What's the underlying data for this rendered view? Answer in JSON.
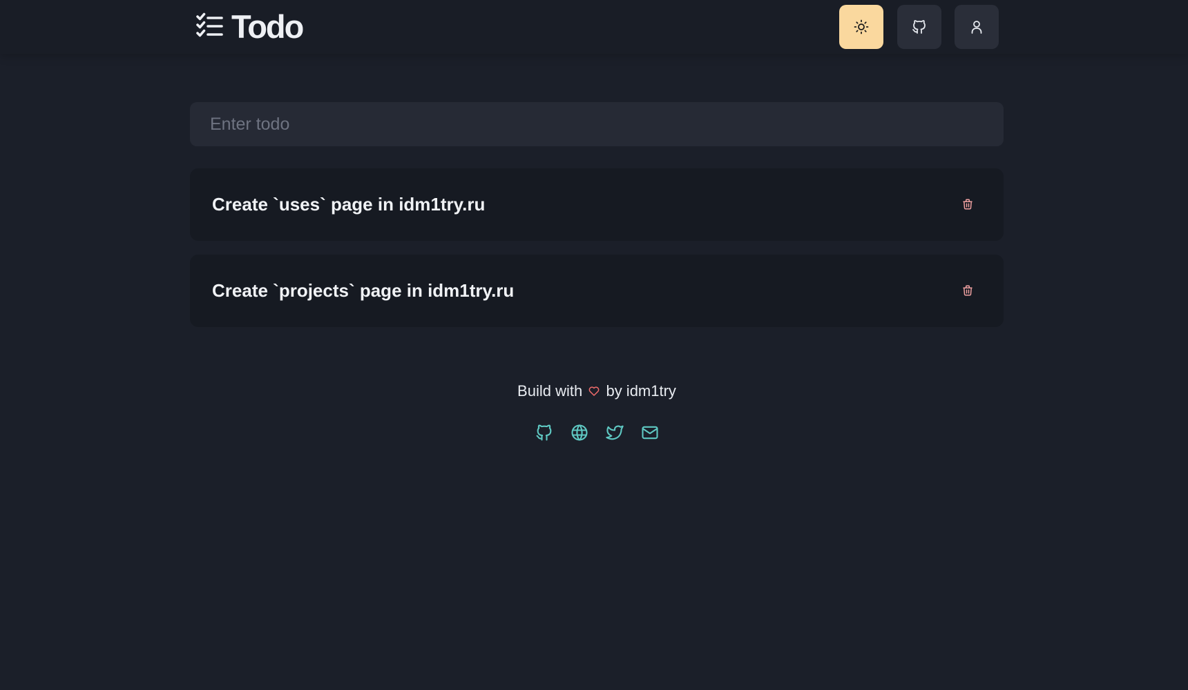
{
  "header": {
    "title": "Todo",
    "buttons": [
      {
        "name": "theme-toggle",
        "icon": "sun-icon"
      },
      {
        "name": "github",
        "icon": "github-icon"
      },
      {
        "name": "account",
        "icon": "user-icon"
      }
    ]
  },
  "input": {
    "placeholder": "Enter todo",
    "value": ""
  },
  "todos": [
    {
      "text": "Create `uses` page in idm1try.ru",
      "action_icon": "trash-icon"
    },
    {
      "text": "Create `projects` page in idm1try.ru",
      "action_icon": "trash-icon"
    }
  ],
  "footer": {
    "text_before": "Build with",
    "heart_icon": "heart-icon",
    "text_after": "by idm1try",
    "social_icons": [
      "github-icon",
      "globe-icon",
      "twitter-icon",
      "mail-icon"
    ]
  },
  "colors": {
    "background": "#1b1f29",
    "accent": "#fad89e",
    "social": "#5fc9c3",
    "trash": "#f0a1a1",
    "heart": "#ef6b6b"
  }
}
